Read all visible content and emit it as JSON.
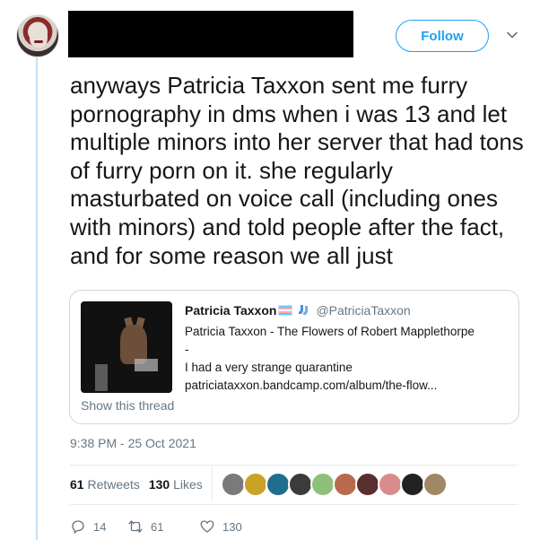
{
  "header": {
    "follow_label": "Follow"
  },
  "tweet": {
    "text": "anyways Patricia Taxxon sent me furry pornography in dms when i was 13 and let multiple minors into her server that had tons of furry porn on it. she regularly masturbated on voice call (including ones with minors) and told people after the fact, and for some reason we all just",
    "timestamp": "9:38 PM - 25 Oct 2021"
  },
  "quote": {
    "author_name": "Patricia Taxxon",
    "author_handle": "@PatriciaTaxxon",
    "lines": [
      "Patricia Taxxon - The Flowers of Robert Mapplethorpe",
      "-",
      "I had a very strange quarantine",
      "patriciataxxon.bandcamp.com/album/the-flow..."
    ],
    "show_thread": "Show this thread"
  },
  "stats": {
    "retweets_count": "61",
    "retweets_label": "Retweets",
    "likes_count": "130",
    "likes_label": "Likes"
  },
  "likers": [
    {
      "icon": "liker-avatar",
      "color": "#7a7a7a"
    },
    {
      "icon": "liker-avatar",
      "color": "#c9a227"
    },
    {
      "icon": "liker-avatar",
      "color": "#1f6e8c"
    },
    {
      "icon": "liker-avatar",
      "color": "#3b3b3b"
    },
    {
      "icon": "liker-avatar",
      "color": "#8fc07a"
    },
    {
      "icon": "liker-avatar",
      "color": "#b86a4e"
    },
    {
      "icon": "liker-avatar",
      "color": "#5a2e2e"
    },
    {
      "icon": "liker-avatar",
      "color": "#d98c8c"
    },
    {
      "icon": "liker-avatar",
      "color": "#222222"
    },
    {
      "icon": "liker-avatar",
      "color": "#a08866"
    }
  ],
  "actions": {
    "reply_count": "14",
    "retweet_count": "61",
    "like_count": "130"
  },
  "colors": {
    "accent": "#1da1f2",
    "muted": "#657786",
    "text": "#14171a"
  }
}
